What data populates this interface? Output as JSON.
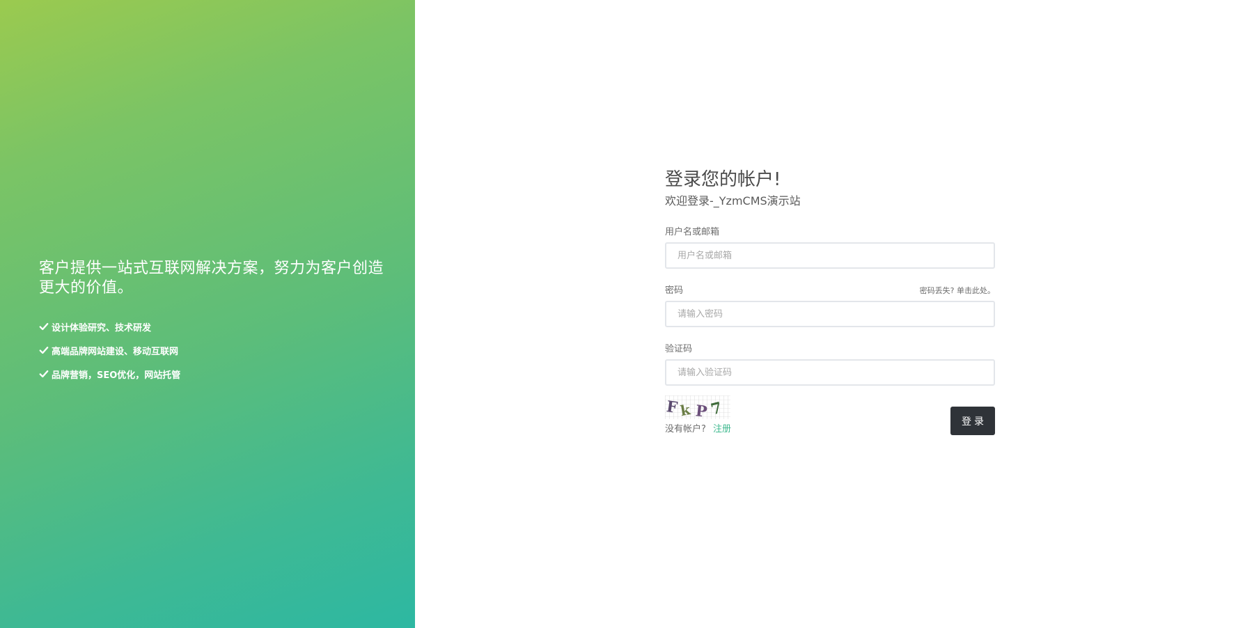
{
  "left_panel": {
    "slogan": "客户提供一站式互联网解决方案，努力为客户创造更大的价值。",
    "features": [
      {
        "icon": "check-icon",
        "text": "设计体验研究、技术研发"
      },
      {
        "icon": "check-icon",
        "text": "高端品牌网站建设、移动互联网"
      },
      {
        "icon": "check-icon",
        "text": "品牌营销，SEO优化，网站托管"
      }
    ],
    "gradient_colors": [
      "#9bca4f",
      "#2db8a2"
    ]
  },
  "login": {
    "title": "登录您的帐户!",
    "subtitle": "欢迎登录-_YzmCMS演示站",
    "username": {
      "label": "用户名或邮箱",
      "placeholder": "用户名或邮箱",
      "value": ""
    },
    "password": {
      "label": "密码",
      "placeholder": "请输入密码",
      "value": "",
      "forgot_prefix": "密码丢失?",
      "forgot_link": "单击此处。"
    },
    "captcha_field": {
      "label": "验证码",
      "placeholder": "请输入验证码",
      "value": ""
    },
    "captcha_image": {
      "text": "FkP7"
    },
    "no_account_text": "没有帐户?",
    "register_link": "注册",
    "submit_label": "登录",
    "colors": {
      "button_bg": "#2f3338",
      "link_accent": "#3fb98f"
    }
  }
}
